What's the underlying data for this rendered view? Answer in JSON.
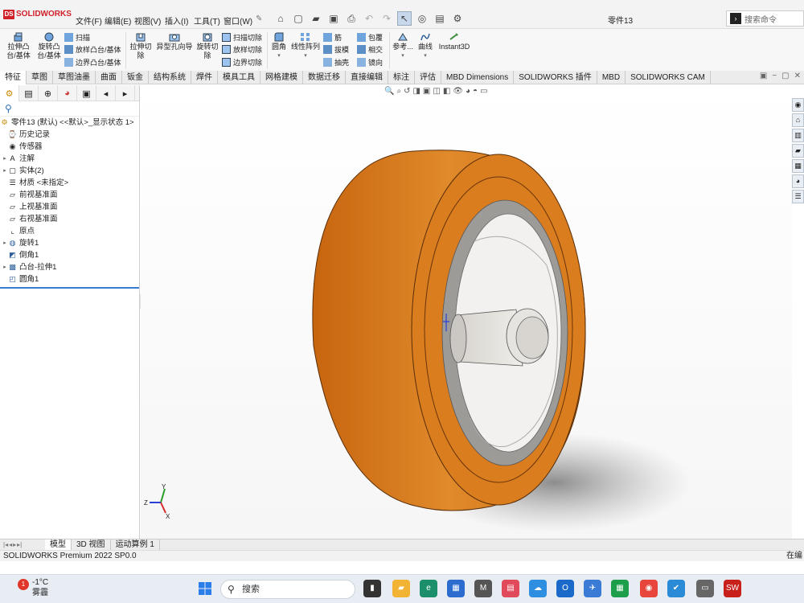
{
  "app": {
    "logo_text": "SOLIDWORKS",
    "doc_title": "零件13"
  },
  "menus": [
    "文件(F)",
    "编辑(E)",
    "视图(V)",
    "插入(I)",
    "工具(T)",
    "窗口(W)"
  ],
  "search": {
    "placeholder": "搜索命令"
  },
  "ribbon": {
    "boss_extrude": "拉伸凸\n台/基体",
    "boss_revolve": "旋转凸\n台/基体",
    "sweep": "扫描",
    "loft": "放样凸台/基体",
    "boundary": "边界凸台/基体",
    "cut_extrude": "拉伸切\n除",
    "hole_wizard": "异型孔向导",
    "cut_revolve": "旋转切\n除",
    "swept_cut": "扫描切除",
    "lofted_cut": "放样切除",
    "boundary_cut": "边界切除",
    "fillet": "圆角",
    "linear_pattern": "线性阵列",
    "rib": "筋",
    "draft": "拔模",
    "shell": "抽壳",
    "wrap": "包覆",
    "intersect": "相交",
    "mirror": "镜向",
    "reference": "参考...",
    "curves": "曲线",
    "instant3d": "Instant3D"
  },
  "tabs": [
    "特征",
    "草图",
    "草图油墨",
    "曲面",
    "钣金",
    "结构系统",
    "焊件",
    "模具工具",
    "网格建模",
    "数据迁移",
    "直接编辑",
    "标注",
    "评估",
    "MBD Dimensions",
    "SOLIDWORKS 插件",
    "MBD",
    "SOLIDWORKS CAM"
  ],
  "tree": {
    "root": "零件13 (默认) <<默认>_显示状态 1>",
    "items": [
      "历史记录",
      "传感器",
      "注解",
      "实体(2)",
      "材质 <未指定>",
      "前视基准面",
      "上视基准面",
      "右视基准面",
      "原点",
      "旋转1",
      "倒角1",
      "凸台-拉伸1",
      "圆角1"
    ]
  },
  "triad": {
    "y": "Y",
    "z": "Z",
    "x": "X"
  },
  "bottom_tabs": [
    "模型",
    "3D 视图",
    "运动算例 1"
  ],
  "status": {
    "left": "SOLIDWORKS Premium 2022 SP0.0",
    "right": "在编"
  },
  "taskbar": {
    "temp": "-1°C",
    "weather": "雾霾",
    "badge": "1",
    "search": "搜索"
  },
  "colors": {
    "tire": "#d87a1e",
    "rim": "#c7c7c7",
    "accent": "#3a7bd5"
  }
}
